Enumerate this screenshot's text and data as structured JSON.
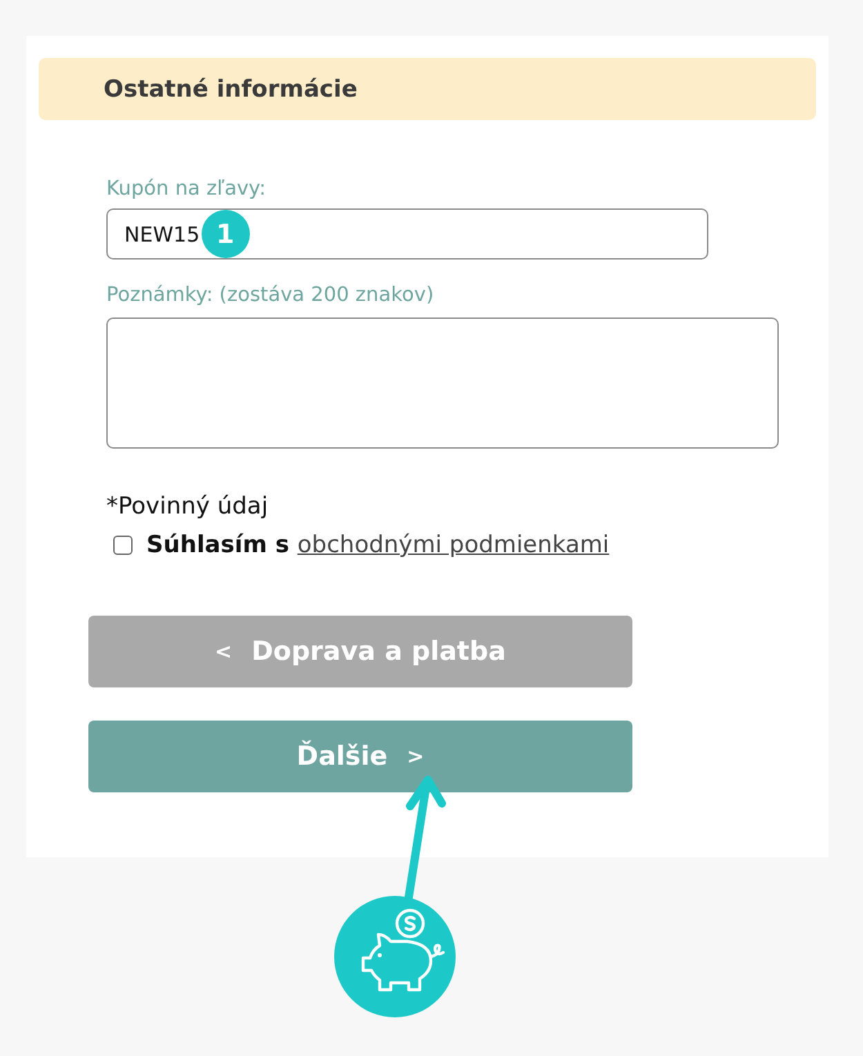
{
  "section": {
    "title": "Ostatné informácie"
  },
  "coupon": {
    "label": "Kupón na zľavy:",
    "value": "NEW15",
    "marker": "1"
  },
  "notes": {
    "label": "Poznámky: (zostáva 200 znakov)"
  },
  "required_note": "*Povinný údaj",
  "terms": {
    "checked": false,
    "text": "Súhlasím s",
    "link": "obchodnými podmienkami"
  },
  "buttons": [
    {
      "kind": "back",
      "label": "Doprava a platba",
      "arrow": "<"
    },
    {
      "kind": "next",
      "label": "Ďalšie",
      "arrow": ">"
    }
  ]
}
